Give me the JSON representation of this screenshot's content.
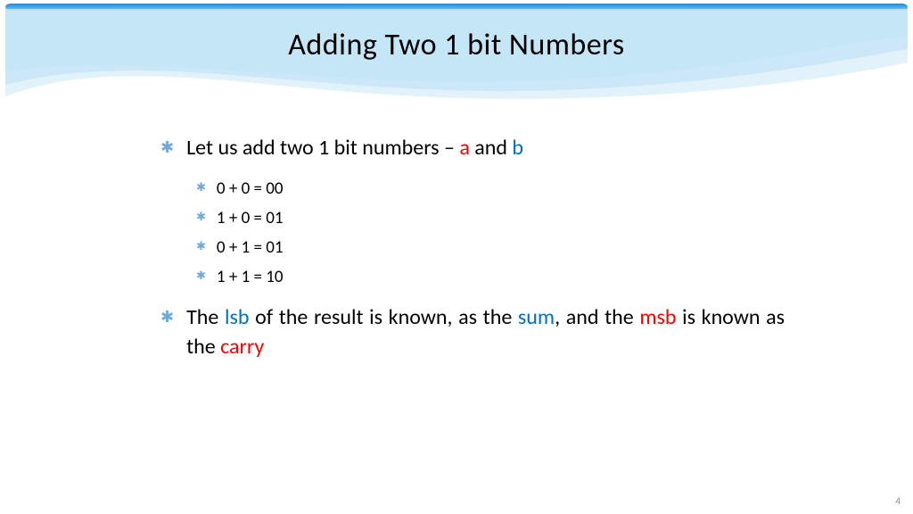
{
  "title": "Adding Two 1 bit Numbers",
  "bullets": {
    "b1_pre": "Let us add two 1 bit numbers – ",
    "b1_a": "a",
    "b1_mid": " and ",
    "b1_b": "b",
    "sub": [
      "0 + 0 = 00",
      "1 + 0 = 01",
      "0 + 1 = 01",
      "1 + 1 = 10"
    ],
    "b2_p1": "The ",
    "b2_lsb": "lsb",
    "b2_p2": " of the result is known, as the ",
    "b2_sum": "sum",
    "b2_p3": ", and the ",
    "b2_msb": "msb",
    "b2_p4": " is known as the ",
    "b2_carry": "carry"
  },
  "bullet_glyph": "✱",
  "page_number": "4"
}
